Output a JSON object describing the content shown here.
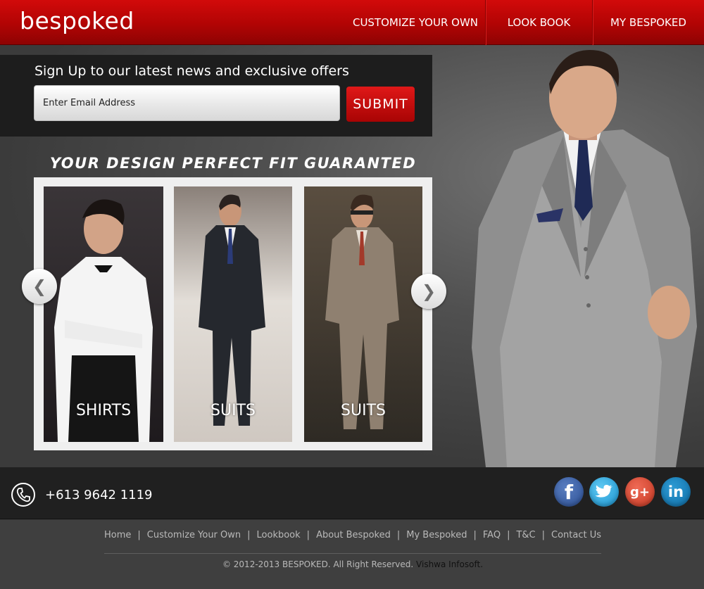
{
  "header": {
    "logo": "bespoked",
    "nav": [
      "CUSTOMIZE YOUR OWN",
      "LOOK BOOK",
      "MY BESPOKED"
    ]
  },
  "signup": {
    "title": "Sign Up to our latest news and exclusive offers",
    "email_placeholder": "Enter Email Address",
    "submit_label": "SUBMIT"
  },
  "tagline": "YOUR DESIGN PERFECT FIT GUARANTED",
  "carousel": {
    "items": [
      {
        "label": "SHIRTS"
      },
      {
        "label": "SUITS"
      },
      {
        "label": "SUITS"
      }
    ],
    "prev_glyph": "❮",
    "next_glyph": "❯"
  },
  "contact": {
    "phone": "+613 9642 1119"
  },
  "social": {
    "facebook": "f",
    "twitter": "t",
    "google_plus": "g+",
    "linkedin": "in"
  },
  "footer": {
    "links": [
      "Home",
      "Customize Your Own",
      "Lookbook",
      "About Bespoked",
      "My Bespoked",
      "FAQ",
      "T&C",
      "Contact Us"
    ],
    "separator": "|",
    "copyright": "© 2012-2013 BESPOKED. All Right Reserved.",
    "credit": "Vishwa Infosoft."
  },
  "colors": {
    "brand_red": "#c00808",
    "dark_band": "#1d1d1d",
    "footer_bg": "#3f3f3f"
  }
}
